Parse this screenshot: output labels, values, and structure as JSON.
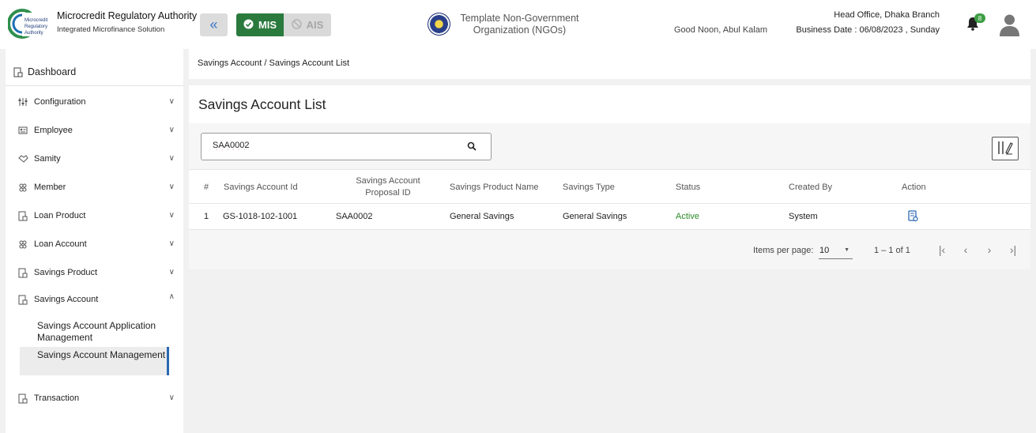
{
  "header": {
    "logo_text": [
      "Microcredit",
      "Regulatory",
      "Authority"
    ],
    "org_title": "Microcredit Regulatory Authority",
    "org_subtitle": "Integrated Microfinance Solution",
    "mis_label": "MIS",
    "ais_label": "AIS",
    "ngo_name_line1": "Template Non-Government",
    "ngo_name_line2": "Organization (NGOs)",
    "greeting": "Good Noon, Abul Kalam",
    "branch": "Head Office, Dhaka Branch",
    "business_date": "Business Date : 06/08/2023 , Sunday",
    "notification_count": "8"
  },
  "sidebar": {
    "dashboard": "Dashboard",
    "items": [
      {
        "label": "Configuration",
        "icon": "sliders-icon",
        "expanded": false
      },
      {
        "label": "Employee",
        "icon": "id-card-icon",
        "expanded": false
      },
      {
        "label": "Samity",
        "icon": "handshake-icon",
        "expanded": false
      },
      {
        "label": "Member",
        "icon": "members-icon",
        "expanded": false
      },
      {
        "label": "Loan Product",
        "icon": "document-icon",
        "expanded": false
      },
      {
        "label": "Loan Account",
        "icon": "members-icon",
        "expanded": false
      },
      {
        "label": "Savings Product",
        "icon": "document-icon",
        "expanded": false
      },
      {
        "label": "Savings Account",
        "icon": "document-icon",
        "expanded": true
      },
      {
        "label": "Transaction",
        "icon": "document-icon",
        "expanded": false
      }
    ],
    "sub_items": [
      {
        "label": "Savings Account Application Management",
        "active": false
      },
      {
        "label": "Savings Account Management",
        "active": true
      }
    ]
  },
  "breadcrumb": {
    "parent": "Savings Account",
    "separator": "/",
    "current": "Savings Account List"
  },
  "page": {
    "title": "Savings Account List"
  },
  "search": {
    "value": "SAA0002",
    "placeholder": ""
  },
  "table": {
    "headers": [
      "#",
      "Savings Account Id",
      "Savings Account Proposal ID",
      "Savings Product Name",
      "Savings Type",
      "Status",
      "Created By",
      "Action"
    ],
    "rows": [
      {
        "index": "1",
        "account_id": "GS-1018-102-1001",
        "proposal_id": "SAA0002",
        "product_name": "General Savings",
        "savings_type": "General Savings",
        "status": "Active",
        "created_by": "System"
      }
    ]
  },
  "paginator": {
    "items_per_page_label": "Items per page:",
    "items_per_page": "10",
    "range": "1 – 1 of 1"
  },
  "colors": {
    "mis_green": "#2a7a3d",
    "active_status": "#2a8a2a",
    "accent_blue": "#2a67b2",
    "badge_green": "#3d9e43"
  }
}
